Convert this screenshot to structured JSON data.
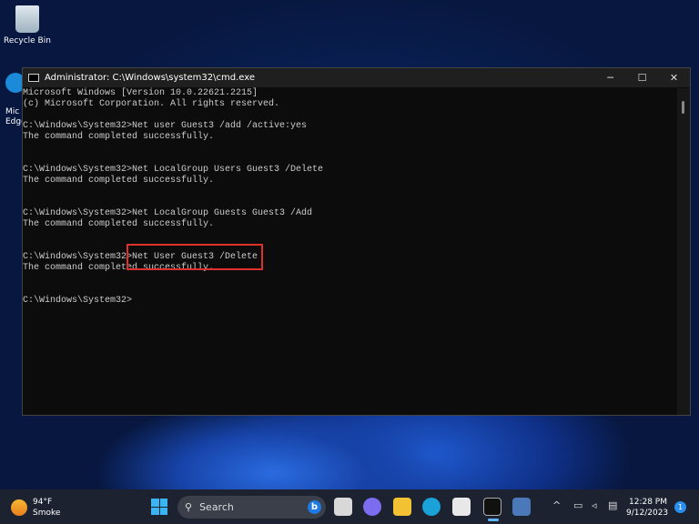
{
  "desktop": {
    "recycle_bin": "Recycle Bin",
    "edge_label_1": "Mic",
    "edge_label_2": "Edge"
  },
  "window": {
    "title": "Administrator: C:\\Windows\\system32\\cmd.exe",
    "minimize": "─",
    "maximize": "☐",
    "close": "✕"
  },
  "console": {
    "lines": [
      "Microsoft Windows [Version 10.0.22621.2215]",
      "(c) Microsoft Corporation. All rights reserved.",
      "",
      "C:\\Windows\\System32>Net user Guest3 /add /active:yes",
      "The command completed successfully.",
      "",
      "",
      "C:\\Windows\\System32>Net LocalGroup Users Guest3 /Delete",
      "The command completed successfully.",
      "",
      "",
      "C:\\Windows\\System32>Net LocalGroup Guests Guest3 /Add",
      "The command completed successfully.",
      "",
      "",
      "C:\\Windows\\System32>Net User Guest3 /Delete",
      "The command completed successfully.",
      "",
      "",
      "C:\\Windows\\System32>"
    ]
  },
  "taskbar": {
    "weather_temp": "94°F",
    "weather_desc": "Smoke",
    "search_label": "Search",
    "search_icon": "⚲",
    "bing": "b",
    "time": "12:28 PM",
    "date": "9/12/2023",
    "notifications": "1",
    "tray_chevron": "^"
  },
  "colors": {
    "highlight": "#e0302c",
    "accent": "#3ab4f2"
  }
}
